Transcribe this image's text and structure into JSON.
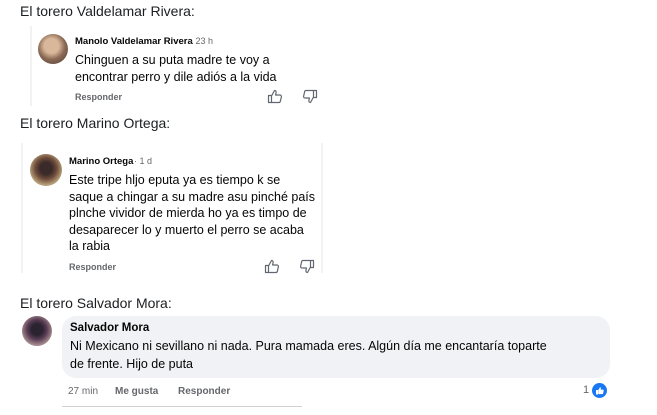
{
  "sections": [
    {
      "heading": "El torero Valdelamar Rivera:",
      "author": "Manolo Valdelamar Rivera",
      "time": "· 23 h",
      "text_lines": [
        "Chinguen a su puta madre te voy a",
        "encontrar perro y dile adiós a la vida"
      ],
      "reply": "Responder"
    },
    {
      "heading": "El torero Marino Ortega:",
      "author": "Marino Ortega",
      "time": "· 1 d",
      "text_lines": [
        "Este tripe hljo eputa ya es tiempo k se",
        "saque a chingar a su madre asu pinché país",
        "plnche vividor de mierda ho ya es timpo de",
        "desaparecer lo y muerto el perro se acaba",
        "la rabia"
      ],
      "reply": "Responder"
    },
    {
      "heading": "El torero Salvador Mora:",
      "author": "Salvador Mora",
      "text_lines": [
        "Ni Mexicano ni sevillano ni nada. Pura mamada eres. Algún día me encantaría toparte",
        "de frente. Hijo de puta"
      ],
      "time": "27 min",
      "like": "Me gusta",
      "reply": "Responder",
      "reaction_count": "1"
    }
  ],
  "icons": [
    "thumbs-up-icon",
    "thumbs-down-icon",
    "like-reaction-icon"
  ],
  "colors": {
    "link_blue": "#1877f2",
    "bubble_gray": "#f0f2f5",
    "meta_gray": "#65676b"
  }
}
